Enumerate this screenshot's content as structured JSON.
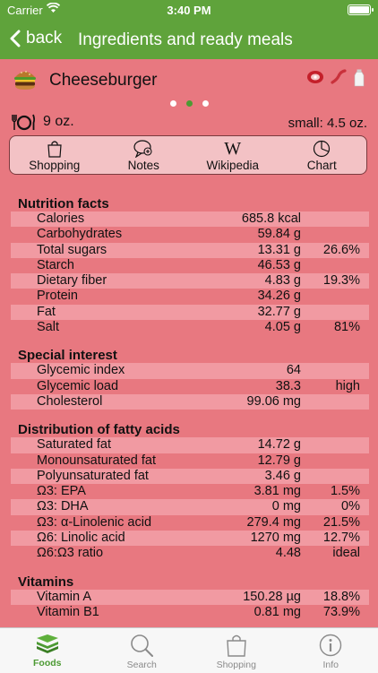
{
  "status": {
    "carrier": "Carrier",
    "time": "3:40 PM"
  },
  "nav": {
    "back_label": "back",
    "title": "Ingredients and ready meals"
  },
  "food": {
    "name": "Cheeseburger",
    "serving": "9 oz.",
    "small_serving": "small: 4.5 oz."
  },
  "page_indicator": {
    "count": 3,
    "active_index": 1
  },
  "toolbar": {
    "shopping": "Shopping",
    "notes": "Notes",
    "wikipedia": "Wikipedia",
    "wiki_glyph": "W",
    "chart": "Chart"
  },
  "sections": [
    {
      "title": "Nutrition facts",
      "rows": [
        {
          "name": "Calories",
          "value": "685.8 kcal",
          "pct": ""
        },
        {
          "name": "Carbohydrates",
          "value": "59.84 g",
          "pct": ""
        },
        {
          "name": "Total sugars",
          "value": "13.31 g",
          "pct": "26.6%"
        },
        {
          "name": "Starch",
          "value": "46.53 g",
          "pct": ""
        },
        {
          "name": "Dietary fiber",
          "value": "4.83 g",
          "pct": "19.3%"
        },
        {
          "name": "Protein",
          "value": "34.26 g",
          "pct": ""
        },
        {
          "name": "Fat",
          "value": "32.77 g",
          "pct": ""
        },
        {
          "name": "Salt",
          "value": "4.05 g",
          "pct": "81%"
        }
      ]
    },
    {
      "title": "Special interest",
      "rows": [
        {
          "name": "Glycemic index",
          "value": "64",
          "pct": ""
        },
        {
          "name": "Glycemic load",
          "value": "38.3",
          "pct": "high"
        },
        {
          "name": "Cholesterol",
          "value": "99.06 mg",
          "pct": ""
        }
      ]
    },
    {
      "title": "Distribution of fatty acids",
      "rows": [
        {
          "name": "Saturated fat",
          "value": "14.72 g",
          "pct": ""
        },
        {
          "name": "Monounsaturated fat",
          "value": "12.79 g",
          "pct": ""
        },
        {
          "name": "Polyunsaturated fat",
          "value": "3.46 g",
          "pct": ""
        },
        {
          "name": "Ω3: EPA",
          "value": "3.81 mg",
          "pct": "1.5%"
        },
        {
          "name": "Ω3: DHA",
          "value": "0 mg",
          "pct": "0%"
        },
        {
          "name": "Ω3: α-Linolenic acid",
          "value": "279.4 mg",
          "pct": "21.5%"
        },
        {
          "name": "Ω6: Linolic acid",
          "value": "1270 mg",
          "pct": "12.7%"
        },
        {
          "name": "Ω6:Ω3 ratio",
          "value": "4.48",
          "pct": "ideal"
        }
      ]
    },
    {
      "title": "Vitamins",
      "rows": [
        {
          "name": "Vitamin A",
          "value": "150.28 µg",
          "pct": "18.8%"
        },
        {
          "name": "Vitamin B1",
          "value": "0.81 mg",
          "pct": "73.9%"
        }
      ]
    }
  ],
  "tabs": [
    {
      "label": "Foods",
      "icon": "stack-icon",
      "active": true
    },
    {
      "label": "Search",
      "icon": "magnifier-icon",
      "active": false
    },
    {
      "label": "Shopping",
      "icon": "bag-icon",
      "active": false
    },
    {
      "label": "Info",
      "icon": "info-icon",
      "active": false
    }
  ],
  "colors": {
    "bar_green": "#5fa33b",
    "background": "#e87880",
    "row_alt": "#f19aa2",
    "active_green": "#4c9a33"
  }
}
